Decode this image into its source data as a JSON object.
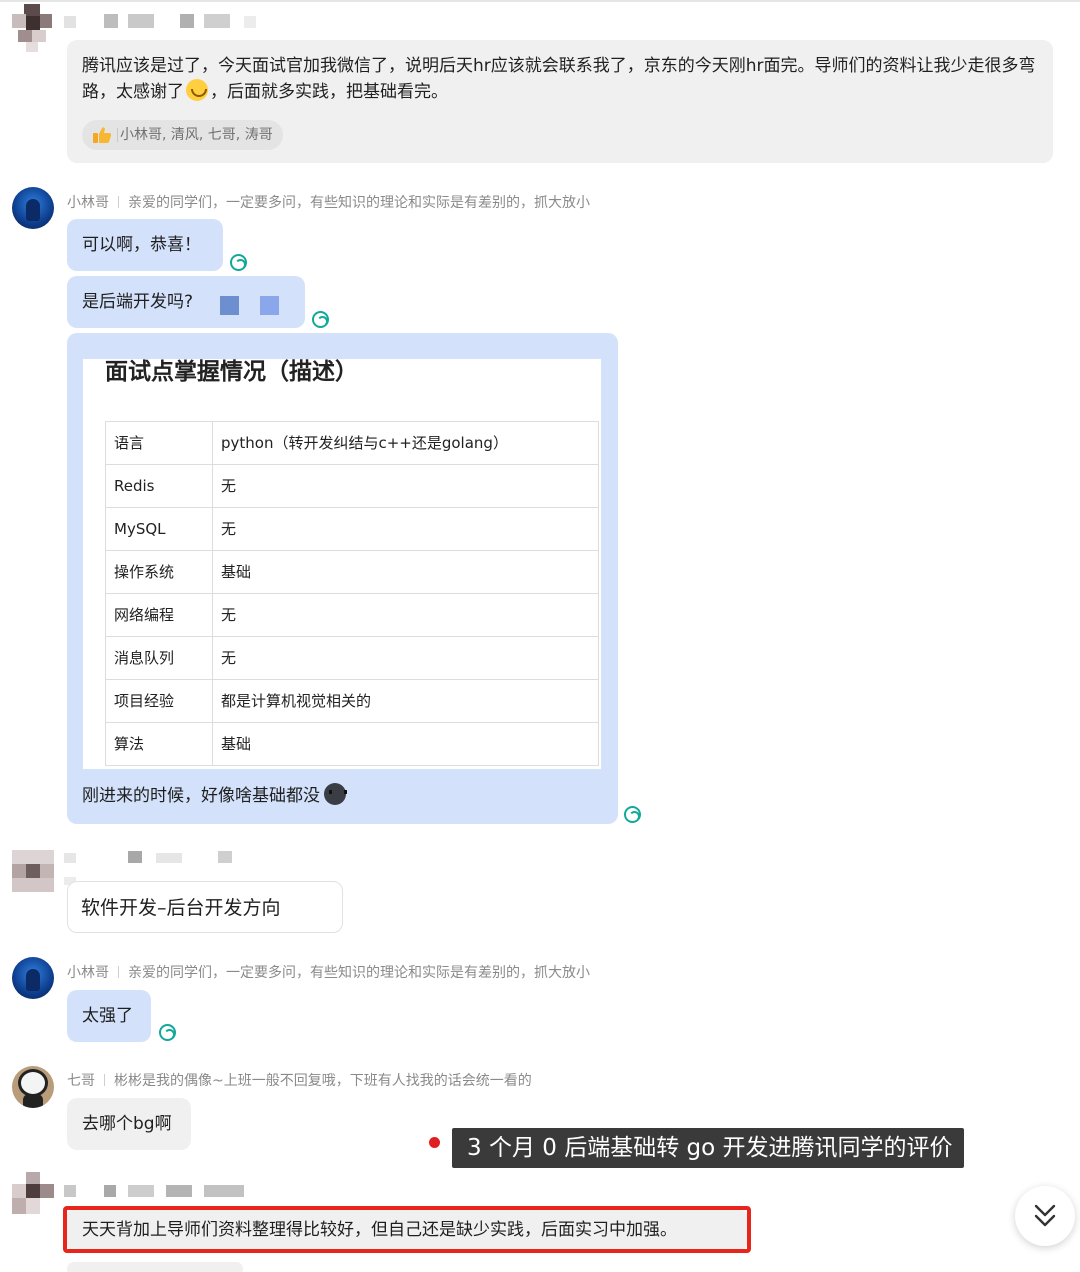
{
  "messages": {
    "m1": {
      "text_before_emoji": "腾讯应该是过了，今天面试官加我微信了，说明后天hr应该就会联系我了，京东的今天刚hr面完。导师们的资料让我少走很多弯路，太感谢了",
      "text_after_emoji": "，后面就多实践，把基础看完。",
      "emoji": "smile-emoji",
      "reaction_users": "小林哥, 清风, 七哥, 涛哥",
      "reaction_icon": "thumbs-up-icon"
    },
    "m2": {
      "sender": "小林哥",
      "signature": "亲爱的同学们，一定要多问，有些知识的理论和实际是有差别的，抓大放小",
      "bubble1": "可以啊，恭喜！",
      "bubble2": "是后端开发吗?",
      "table_title": "面试点掌握情况（描述）",
      "table_rows": [
        {
          "label": "语言",
          "value": "python（转开发纠结与c++还是golang）"
        },
        {
          "label": "Redis",
          "value": "无"
        },
        {
          "label": "MySQL",
          "value": "无"
        },
        {
          "label": "操作系统",
          "value": "基础"
        },
        {
          "label": "网络编程",
          "value": "无"
        },
        {
          "label": "消息队列",
          "value": "无"
        },
        {
          "label": "项目经验",
          "value": "都是计算机视觉相关的"
        },
        {
          "label": "算法",
          "value": "基础"
        }
      ],
      "caption": "刚进来的时候，好像啥基础都没"
    },
    "m3": {
      "text": "软件开发–后台开发方向"
    },
    "m4": {
      "sender": "小林哥",
      "signature": "亲爱的同学们，一定要多问，有些知识的理论和实际是有差别的，抓大放小",
      "text": "太强了"
    },
    "m5": {
      "sender": "七哥",
      "signature": "彬彬是我的偶像~上班一般不回复哦，下班有人找我的话会统一看的",
      "text": "去哪个bg啊"
    },
    "m6": {
      "text": "天天背加上导师们资料整理得比较好，但自己还是缺少实践，后面实习中加强。"
    }
  },
  "overlay": {
    "callout": "3 个月 0 后端基础转 go 开发进腾讯同学的评价"
  },
  "colors": {
    "bubble_gray": "#f0f0f0",
    "bubble_blue": "#d3e1fb",
    "read_icon": "#12a89a",
    "highlight_red": "#e8251c",
    "callout_bg": "#3a3a3a"
  }
}
